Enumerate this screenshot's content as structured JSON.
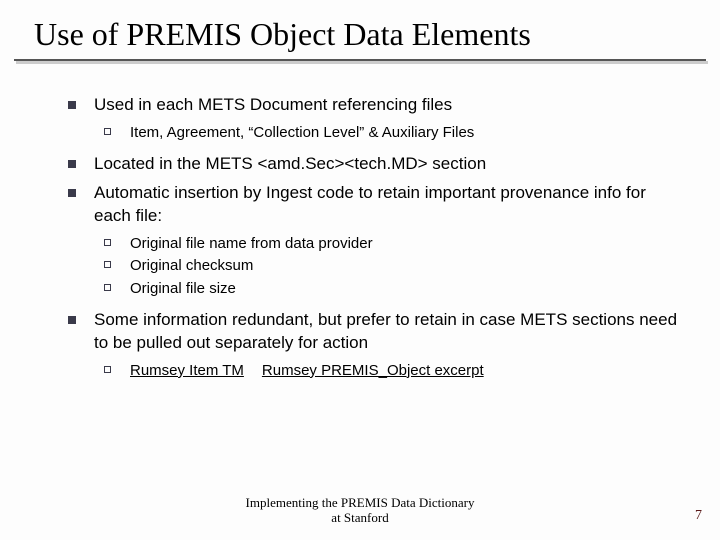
{
  "title": "Use of PREMIS Object Data Elements",
  "bullets": {
    "b1": "Used in each METS Document referencing files",
    "b1_sub1": "Item, Agreement, “Collection Level” & Auxiliary Files",
    "b2": "Located in the METS <amd.Sec><tech.MD> section",
    "b3": "Automatic insertion by Ingest code to retain important provenance info for each file:",
    "b3_sub1": "Original file name from data provider",
    "b3_sub2": "Original checksum",
    "b3_sub3": "Original file size",
    "b4": "Some information redundant, but prefer to retain in case METS sections need to be pulled out separately for action",
    "b4_link1": "Rumsey Item TM",
    "b4_link2": "Rumsey PREMIS_Object excerpt"
  },
  "footer_line1": "Implementing the PREMIS Data Dictionary",
  "footer_line2": "at Stanford",
  "page_number": "7"
}
